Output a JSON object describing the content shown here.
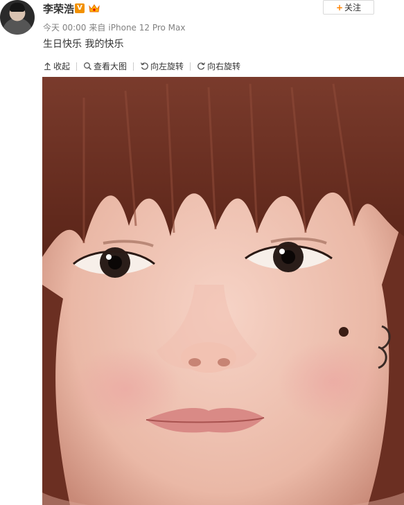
{
  "post": {
    "username": "李荣浩",
    "verified_badge": "V",
    "time": "今天 00:00",
    "source_prefix": "来自",
    "device": "iPhone 12 Pro Max",
    "text": "生日快乐 我的快乐",
    "follow_label": "关注"
  },
  "toolbar": {
    "collapse": "收起",
    "view_large": "查看大图",
    "rotate_left": "向左旋转",
    "rotate_right": "向右旋转"
  },
  "icons": {
    "verified": "verified-v-icon",
    "member": "crown-member-icon",
    "collapse": "arrow-up-icon",
    "view_large": "magnifier-icon",
    "rotate_left": "rotate-left-icon",
    "rotate_right": "rotate-right-icon",
    "follow": "plus-icon"
  },
  "colors": {
    "accent_orange": "#ff8200",
    "verified_orange": "#f29100",
    "meta_gray": "#808080"
  }
}
